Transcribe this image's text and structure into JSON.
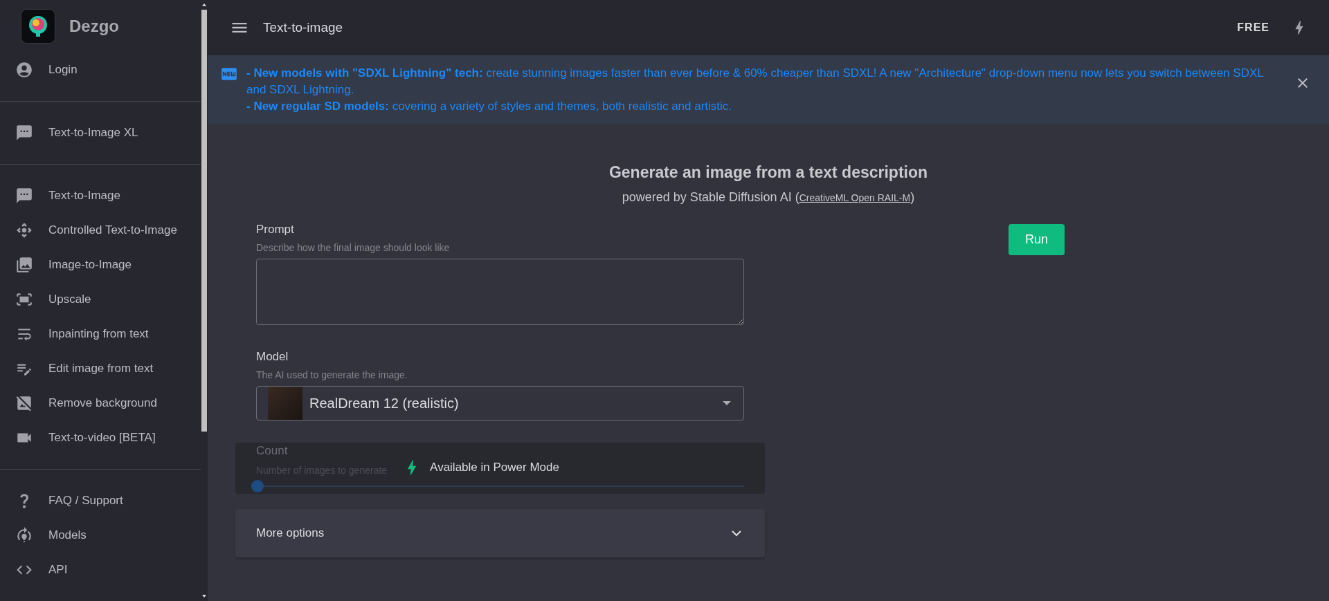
{
  "sidebar": {
    "brand": "Dezgo",
    "sections": [
      {
        "items": [
          {
            "label": "Login",
            "selected": false
          }
        ]
      },
      {
        "items": [
          {
            "label": "Text-to-Image XL",
            "selected": false
          }
        ]
      },
      {
        "items": [
          {
            "label": "Text-to-Image",
            "selected": false
          },
          {
            "label": "Controlled Text-to-Image",
            "selected": false
          },
          {
            "label": "Image-to-Image",
            "selected": false
          },
          {
            "label": "Upscale",
            "selected": false
          },
          {
            "label": "Inpainting from text",
            "selected": false
          },
          {
            "label": "Edit image from text",
            "selected": false
          },
          {
            "label": "Remove background",
            "selected": false
          },
          {
            "label": "Text-to-video [BETA]",
            "selected": false
          }
        ]
      },
      {
        "items": [
          {
            "label": "FAQ / Support",
            "selected": false
          },
          {
            "label": "Models",
            "selected": false
          },
          {
            "label": "API",
            "selected": false
          }
        ]
      }
    ]
  },
  "header": {
    "title": "Text-to-image",
    "plan": "FREE"
  },
  "banner": {
    "lines": [
      "**- New models with \"SDXL Lightning\" tech:** create stunning images faster than ever before & 60% cheaper than SDXL! A new \"Architecture\" drop-down menu now lets you switch between SDXL and SDXL Lightning.",
      "**- New regular SD models:** covering a variety of styles and themes, both realistic and artistic."
    ]
  },
  "heading": {
    "title": "Generate an image from a text description",
    "subtitle_prefix": "powered by Stable Diffusion AI (",
    "license_link": "CreativeML Open RAIL-M",
    "subtitle_suffix": ")"
  },
  "form": {
    "prompt": {
      "label": "Prompt",
      "hint": "Describe how the final image should look like"
    },
    "model": {
      "label": "Model",
      "hint": "The AI used to generate the image.",
      "value": "RealDream 12 (realistic)"
    },
    "count": {
      "label": "Count",
      "hint": "Number of images to generate",
      "disabled": true,
      "level": 0,
      "notice": "Available in Power Mode"
    },
    "more_options": {
      "label": "More options",
      "expanded": false
    }
  },
  "run_button": "Run"
}
